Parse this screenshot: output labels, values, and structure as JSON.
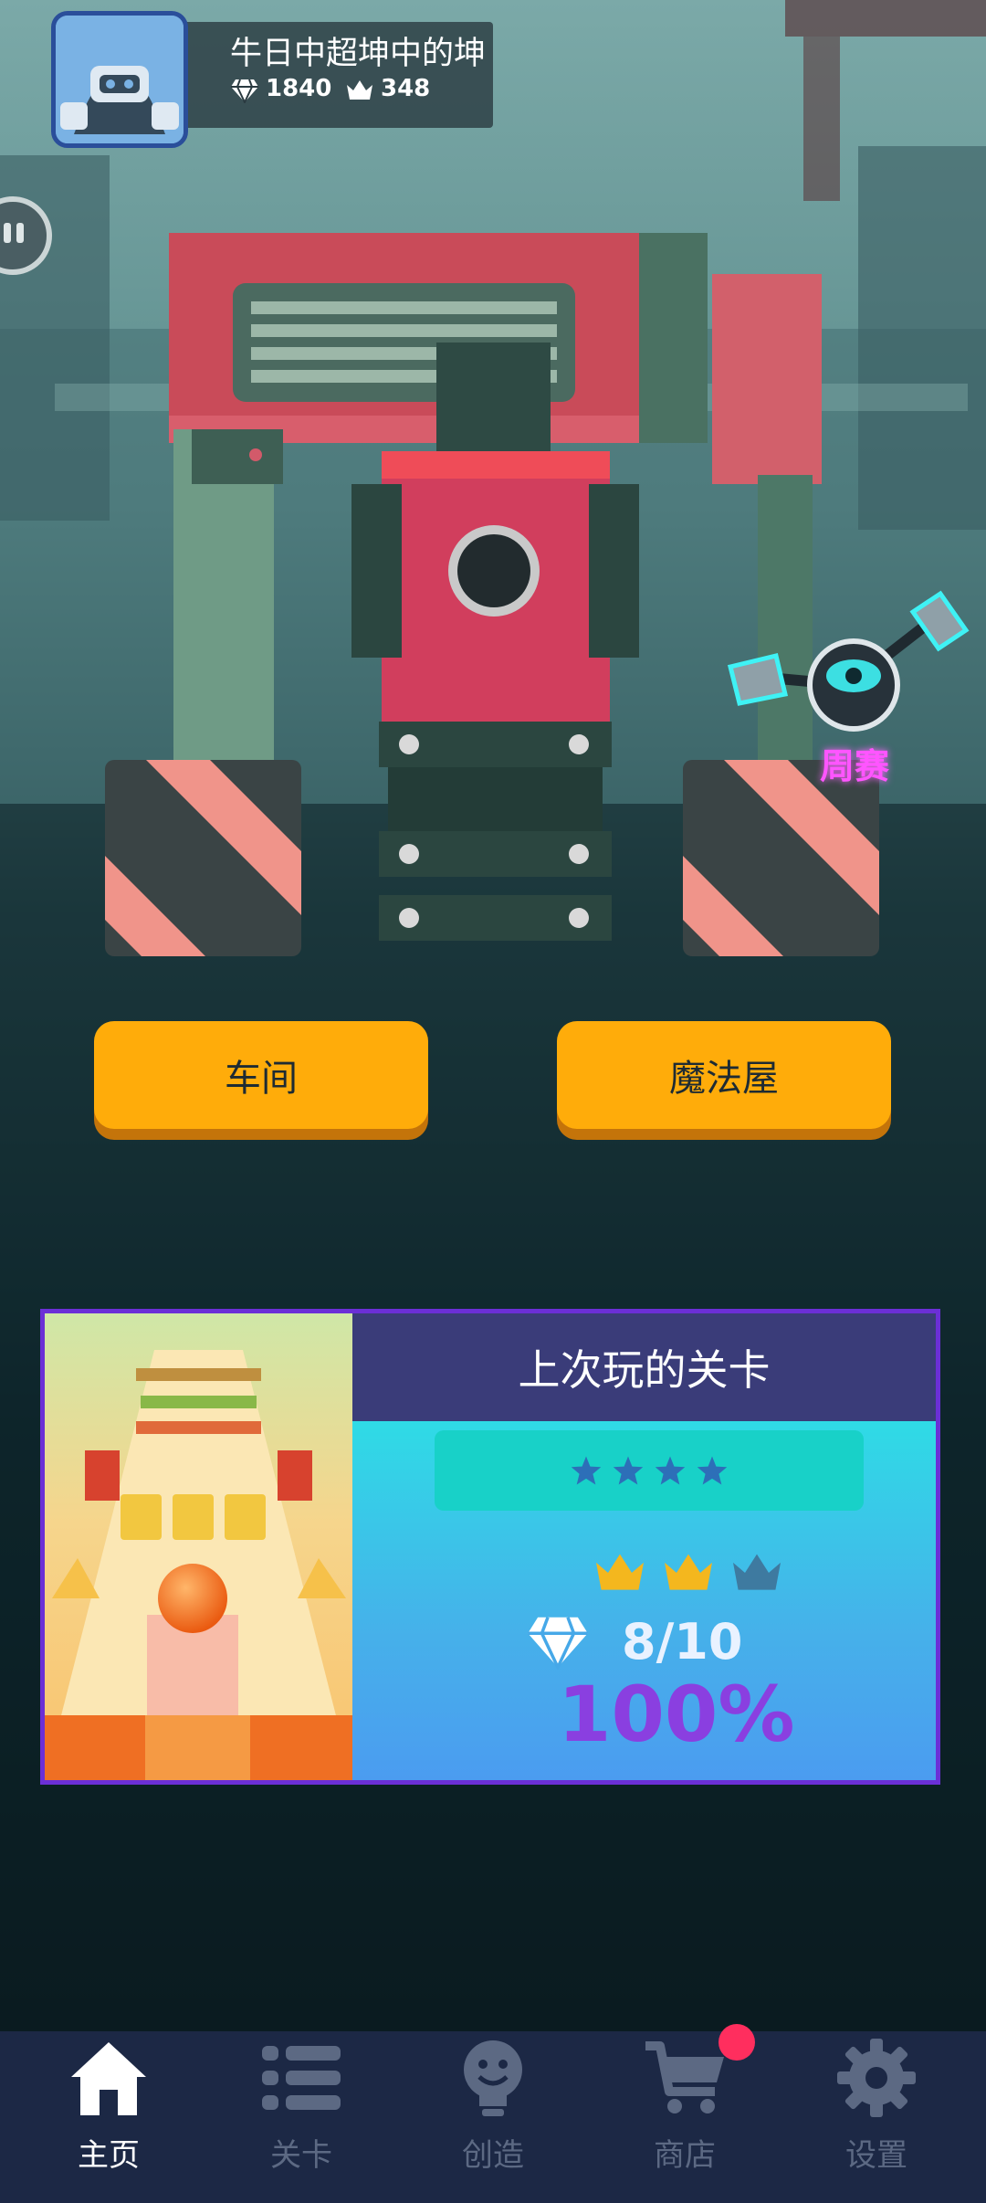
{
  "profile": {
    "name": "牛日中超坤中的坤",
    "diamonds": "1840",
    "crowns": "348",
    "avatar_icon": "robot-avatar-icon"
  },
  "event": {
    "weekly_label": "周赛"
  },
  "buttons": {
    "workshop": "车间",
    "magic_house": "魔法屋"
  },
  "last_level": {
    "title": "上次玩的关卡",
    "stars": 4,
    "crowns_earned": 2,
    "crowns_total": 3,
    "gems": "8/10",
    "progress": "100%"
  },
  "nav": {
    "items": [
      {
        "label": "主页",
        "icon": "home-icon",
        "active": true
      },
      {
        "label": "关卡",
        "icon": "list-icon",
        "active": false
      },
      {
        "label": "创造",
        "icon": "lightbulb-icon",
        "active": false
      },
      {
        "label": "商店",
        "icon": "cart-icon",
        "active": false
      },
      {
        "label": "设置",
        "icon": "gear-icon",
        "active": false
      }
    ]
  },
  "colors": {
    "accent_button": "#ffac0a",
    "card_border": "#6b2fd6",
    "weekly_label": "#ff55ff",
    "percent": "#8a3fe0",
    "crown_gold": "#f4b71e",
    "crown_empty": "#3e7aa0"
  }
}
